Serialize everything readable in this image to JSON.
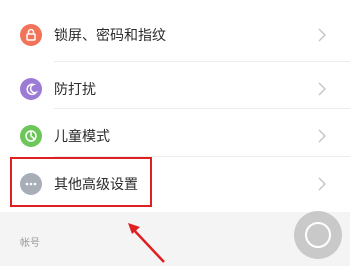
{
  "settings": {
    "items": [
      {
        "label": "锁屏、密码和指纹",
        "icon": "lock-icon",
        "color": "#f0735a"
      },
      {
        "label": "防打扰",
        "icon": "moon-icon",
        "color": "#9b7bd6"
      },
      {
        "label": "儿童模式",
        "icon": "kids-icon",
        "color": "#6cc65a"
      },
      {
        "label": "其他高级设置",
        "icon": "more-icon",
        "color": "#a8aeb8"
      }
    ],
    "section_header": "帐号"
  },
  "colors": {
    "highlight": "#e02020",
    "float_button": "#c9c9c9"
  }
}
